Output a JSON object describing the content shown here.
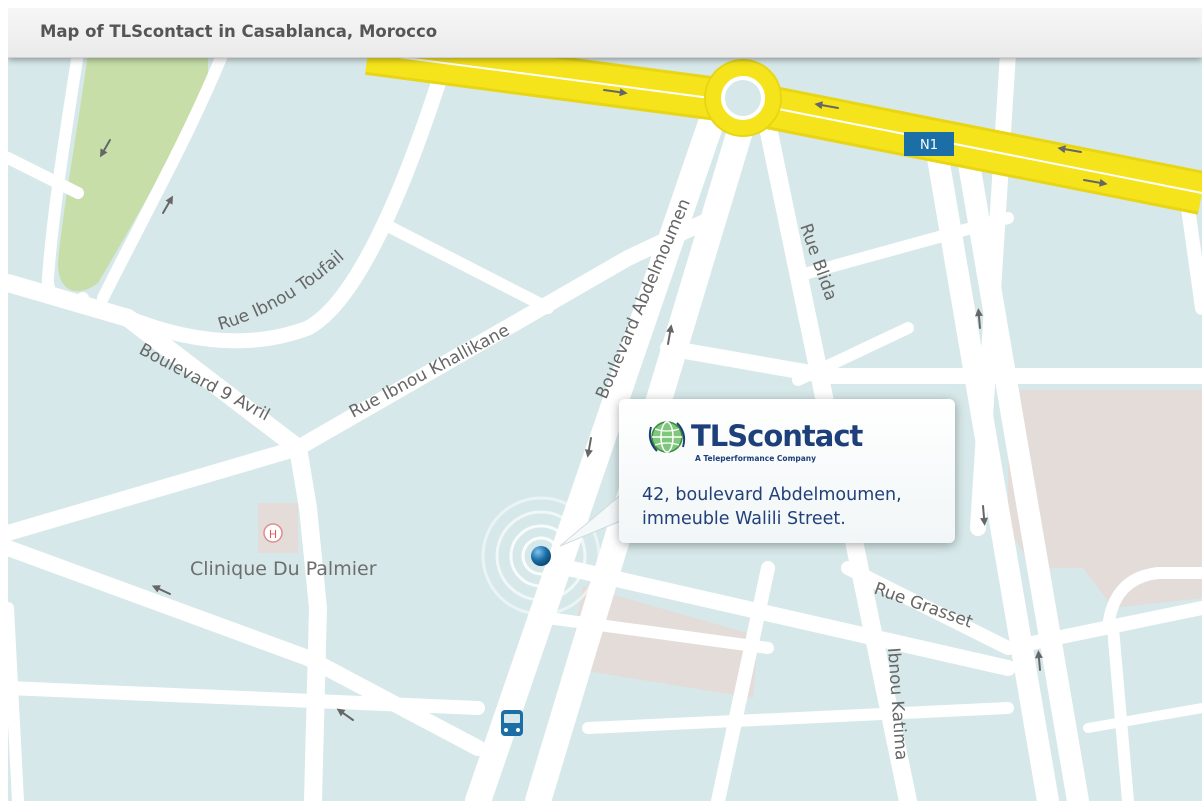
{
  "header": {
    "title": "Map of TLScontact in Casablanca, Morocco"
  },
  "highway": {
    "shield_label": "N1"
  },
  "streets": {
    "ibnou_toufail": "Rue Ibnou Toufail",
    "ibnou_khallikane": "Rue Ibnou Khallikane",
    "boulevard_9_avril": "Boulevard 9 Avril",
    "boulevard_abdelmoumen": "Boulevard Abdelmoumen",
    "rue_blida": "Rue Blida",
    "rue_grasset": "Rue Grasset",
    "ibnou_katima": "Ibnou Katima"
  },
  "pois": {
    "clinic_name": "Clinique Du Palmier",
    "clinic_symbol": "H"
  },
  "callout": {
    "brand": "TLScontact",
    "tagline": "A Teleperformance Company",
    "address_line1": "42, boulevard Abdelmoumen,",
    "address_line2": "immeuble Walili Street."
  },
  "icons": [
    "hospital-icon",
    "location-pin-icon",
    "bus-stop-icon",
    "globe-logo-icon",
    "direction-arrow-icon"
  ],
  "colors": {
    "water": "#d6e8e9",
    "road": "#ffffff",
    "highway": "#f5e41c",
    "park": "#c7dea9",
    "building": "#e3dcd9",
    "shield": "#1b6ea6",
    "brand": "#1d3f7a",
    "pin": "#1b6ea6"
  }
}
